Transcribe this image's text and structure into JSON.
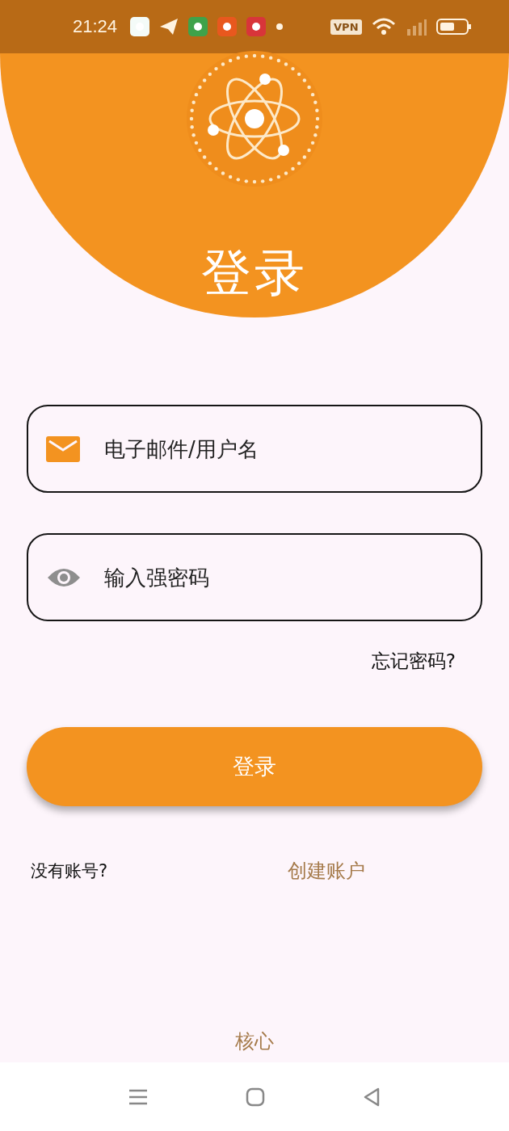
{
  "status_bar": {
    "time": "21:24",
    "vpn": "VPN"
  },
  "header": {
    "title": "登录"
  },
  "fields": [
    {
      "kind": "email",
      "placeholder": "电子邮件/用户名"
    },
    {
      "kind": "password",
      "placeholder": "输入强密码"
    }
  ],
  "forgot_link": "忘记密码?",
  "login_button": "登录",
  "signup": {
    "prompt": "没有账号?",
    "link": "创建账户"
  },
  "footer": "核心"
}
